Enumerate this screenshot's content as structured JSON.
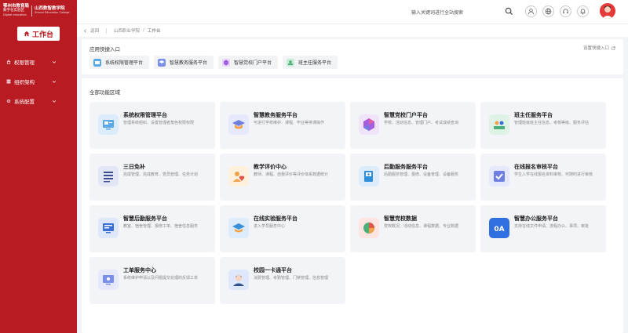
{
  "logo": {
    "left_line1": "鄂州市教育局",
    "left_line2": "数字化实验区",
    "left_line3": "Digital education",
    "right_line1": "山西数智教学院",
    "right_line2": "Shanxi Education College"
  },
  "sidebar": {
    "workbench_label": "工作台",
    "items": [
      {
        "label": "权限管理",
        "icon": "lock-icon"
      },
      {
        "label": "组织架构",
        "icon": "org-icon"
      },
      {
        "label": "系统配置",
        "icon": "settings-icon"
      }
    ]
  },
  "header": {
    "search_placeholder": "输入关键词进行全站搜索",
    "icons": [
      "user-icon",
      "globe-icon",
      "support-icon",
      "bell-icon"
    ]
  },
  "breadcrumb": {
    "back": "返回",
    "items": [
      "山西职业学院",
      "工作台"
    ]
  },
  "quick_entry": {
    "title": "应用快捷入口",
    "settings_label": "设置快捷入口",
    "items": [
      {
        "label": "系统权限管理平台",
        "color": "#5aa9e6"
      },
      {
        "label": "智慧教务服务平台",
        "color": "#7b8ee8"
      },
      {
        "label": "智慧党校门户平台",
        "color": "#b57be0"
      },
      {
        "label": "班主任服务平台",
        "color": "#6cc08a"
      }
    ]
  },
  "all_functions": {
    "title": "全部功能区域",
    "cards": [
      {
        "title": "系统权限管理平台",
        "desc": "管理系统组织、设置管理者角色权限权限",
        "icon": "settings-panel-icon",
        "color": "#5aa9e6",
        "bg": "#dcecfb"
      },
      {
        "title": "智慧教务服务平台",
        "desc": "可进行学校维护、课程、毕业等排课操作",
        "icon": "graduation-cap-icon",
        "color": "#6f7fe0",
        "bg": "#e6e8fb"
      },
      {
        "title": "智慧党校门户平台",
        "desc": "学校、活动信息、管理门户、考试成绩查询",
        "icon": "hexagon-icon",
        "color": "#a45de0",
        "bg": "#f0e4fb"
      },
      {
        "title": "班主任服务平台",
        "desc": "管理班级班主任信息、考核等级、服务评估",
        "icon": "class-icon",
        "color": "#4cae78",
        "bg": "#dff2e6"
      },
      {
        "title": "三日免补",
        "desc": "完成管理、完成教育、党员管理、任务计划",
        "icon": "list-icon",
        "color": "#3d4b8f",
        "bg": "#e3e6f5"
      },
      {
        "title": "教学评价中心",
        "desc": "教师、课程、自我评价等评价体系数据统计",
        "icon": "evaluation-icon",
        "color": "#f0a24a",
        "bg": "#fdf0dc"
      },
      {
        "title": "后勤服务服务平台",
        "desc": "后勤服务管理、报修、设备管理、设备服务",
        "icon": "book-icon",
        "color": "#2f8ed9",
        "bg": "#dcecfb"
      },
      {
        "title": "在线报名审核平台",
        "desc": "学生入学在线报名资料审核、可随时进行审核",
        "icon": "check-icon",
        "color": "#6f7fe0",
        "bg": "#e6e8fb"
      },
      {
        "title": "智慧后勤服务平台",
        "desc": "教室、宿舍管理、报修工单、宿舍信息服务",
        "icon": "screen-icon",
        "color": "#3d6fd9",
        "bg": "#dfe8fb"
      },
      {
        "title": "在线实验服务平台",
        "desc": "进入学员服务中心",
        "icon": "stack-icon",
        "color": "#3d8ed9",
        "bg": "#dcecfb"
      },
      {
        "title": "智慧党校数据",
        "desc": "党校概况、活动信息、课程数据、专业数据",
        "icon": "pie-chart-icon",
        "color": "#e0564a",
        "bg": "#fde4e0"
      },
      {
        "title": "智慧办公服务平台",
        "desc": "支持在线文件申请、流程办公、事项、审批",
        "icon": "oa-icon",
        "color": "#ffffff",
        "bg": "#2f6fe0"
      },
      {
        "title": "工单服务中心",
        "desc": "系统维护申请以及问题提交处理的反馈工单",
        "icon": "monitor-icon",
        "color": "#7b8ee8",
        "bg": "#e6e8fb"
      },
      {
        "title": "校园一卡通平台",
        "desc": "消费管理、考勤管理、门禁管理、信息管理",
        "icon": "person-icon",
        "color": "#2f4f8f",
        "bg": "#dfe8fb"
      }
    ]
  }
}
